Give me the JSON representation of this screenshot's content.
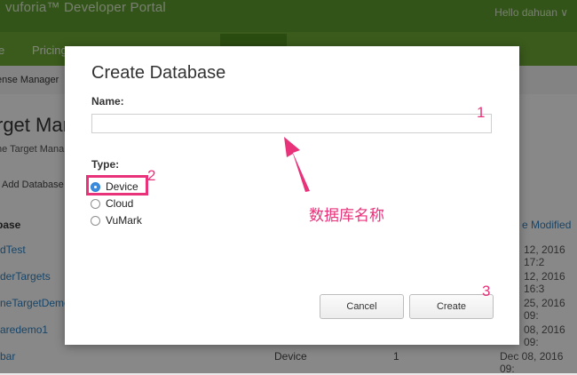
{
  "colors": {
    "accent_green": "#6aa634",
    "annotation_pink": "#e8327a",
    "radio_blue": "#3b8de0"
  },
  "header": {
    "brand": "vuforia™ Developer Portal",
    "greeting": "Hello dahuan ∨"
  },
  "nav": {
    "items": [
      "e",
      "Pricing"
    ]
  },
  "subnav": {
    "license_manager": "ense Manager"
  },
  "page": {
    "title": "rget Man",
    "subtitle": "he Target Mana",
    "add_database": "Add Database"
  },
  "table": {
    "headers": {
      "database": "base",
      "modified": "e Modified"
    },
    "rows": [
      {
        "name": "dTest",
        "date": "12, 2016 17:2"
      },
      {
        "name": "derTargets",
        "date": "12, 2016 16:3"
      },
      {
        "name": "neTargetDemo",
        "date": "25, 2016 09:"
      },
      {
        "name": "aredemo1",
        "date": "08, 2016 09:"
      },
      {
        "name": "bar",
        "type": "Device",
        "count": "1",
        "date": "Dec 08, 2016 09:"
      }
    ]
  },
  "modal": {
    "title": "Create Database",
    "name_label": "Name:",
    "name_value": "",
    "type_label": "Type:",
    "types": [
      {
        "label": "Device",
        "selected": true
      },
      {
        "label": "Cloud",
        "selected": false
      },
      {
        "label": "VuMark",
        "selected": false
      }
    ],
    "cancel": "Cancel",
    "create": "Create"
  },
  "annotations": {
    "n1": "1",
    "n2": "2",
    "n3": "3",
    "note": "数据库名称"
  }
}
